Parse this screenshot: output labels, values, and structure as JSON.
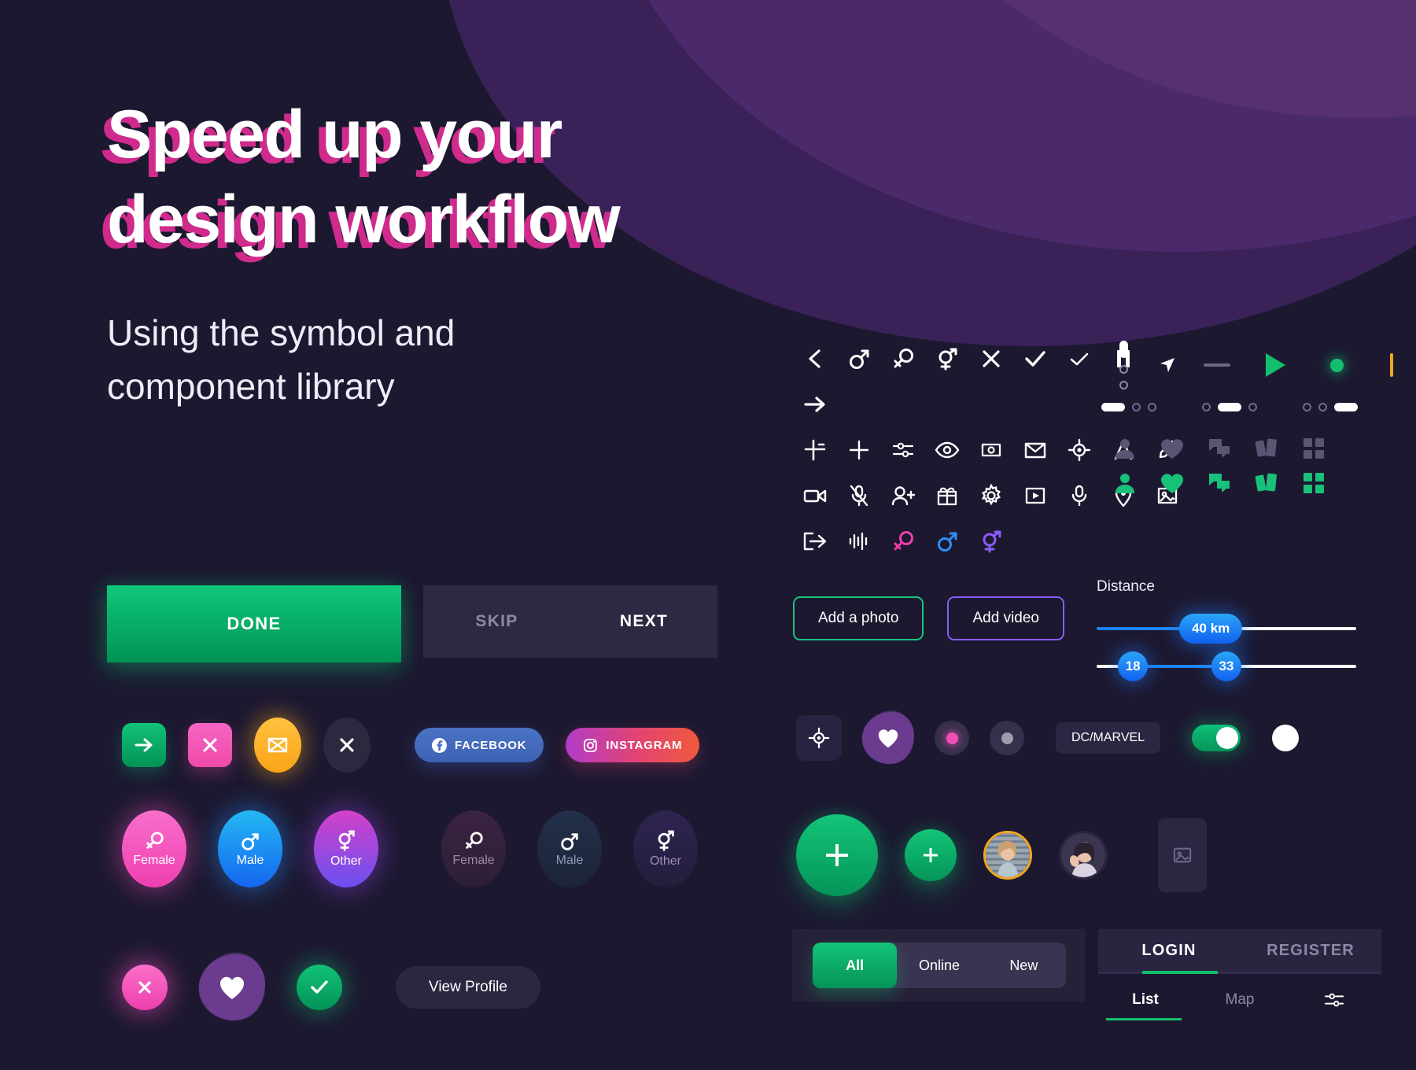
{
  "hero": {
    "title_line1": "Speed up your",
    "title_line2": "design workflow",
    "subtitle_line1": "Using the symbol and",
    "subtitle_line2": "component library"
  },
  "colors": {
    "background": "#1c1830",
    "accent_green": "#13bf6d",
    "accent_pink": "#ef3fb0",
    "accent_blue": "#1f8ef5",
    "accent_purple": "#8a5cf6",
    "accent_yellow": "#f5a623",
    "shadow_magenta": "#cf2b8c",
    "surface": "#2e2943",
    "muted_text": "#8e88a5"
  },
  "icon_grid": {
    "rows": [
      [
        "chevron-left-icon",
        "male-icon",
        "female-icon",
        "transgender-icon",
        "close-icon",
        "check-icon",
        "check-thin-icon",
        "pause-icon"
      ],
      [
        "arrow-right-icon"
      ],
      [
        "crop-icon",
        "crosshair-icon",
        "sliders-icon",
        "eye-icon",
        "photo-swap-icon",
        "mail-icon",
        "target-icon",
        "navigation-icon",
        "edit-icon"
      ],
      [
        "video-camera-icon",
        "mic-off-icon",
        "user-add-icon",
        "gift-icon",
        "gear-icon",
        "play-box-icon",
        "microphone-icon",
        "location-pin-icon",
        "image-icon"
      ],
      [
        "logout-icon",
        "audio-wave-icon",
        "female-pink-icon",
        "male-blue-icon",
        "transgender-purple-icon"
      ]
    ]
  },
  "control_strip": {
    "items": [
      "vertical-dots-indicator",
      "navigation-arrow-icon",
      "dash-line",
      "play-triangle-icon",
      "green-dot-indicator",
      "yellow-bar-indicator",
      "scatter-dots-icon",
      "ellipsis-pill-button"
    ],
    "pagers": [
      {
        "active_index": 0,
        "count": 3
      },
      {
        "active_index": 1,
        "count": 3
      },
      {
        "active_index": 2,
        "count": 3
      }
    ],
    "tab_icons": [
      "person-icon",
      "heart-icon",
      "chat-icon",
      "cards-icon",
      "grid-icon"
    ]
  },
  "cta": {
    "done_label": "DONE",
    "skip_label": "SKIP",
    "next_label": "NEXT"
  },
  "action_chips": {
    "arrow_icon": "arrow-right-icon",
    "close_icon": "close-icon",
    "mail_icon": "mail-icon",
    "close_dark_icon": "close-icon",
    "facebook_label": "FACEBOOK",
    "instagram_label": "INSTAGRAM"
  },
  "gender_options": {
    "active": [
      {
        "label": "Female",
        "icon": "female-icon"
      },
      {
        "label": "Male",
        "icon": "male-icon"
      },
      {
        "label": "Other",
        "icon": "transgender-icon"
      }
    ],
    "inactive": [
      {
        "label": "Female",
        "icon": "female-icon"
      },
      {
        "label": "Male",
        "icon": "male-icon"
      },
      {
        "label": "Other",
        "icon": "transgender-icon"
      }
    ]
  },
  "bottom_actions": {
    "dislike_icon": "close-icon",
    "favorite_icon": "heart-icon",
    "like_icon": "check-icon",
    "view_profile_label": "View Profile"
  },
  "media_buttons": {
    "add_photo_label": "Add a photo",
    "add_video_label": "Add video"
  },
  "sliders": {
    "distance_label": "Distance",
    "distance_value": "40 km",
    "distance_percent": 44,
    "range_min_value": "18",
    "range_max_value": "33",
    "range_min_percent": 14,
    "range_max_percent": 50
  },
  "misc_controls": {
    "target_icon": "target-icon",
    "heart_blob_icon": "heart-icon",
    "dot_pink": "dot-indicator",
    "dot_gray": "dot-indicator",
    "chip_label": "DC/MARVEL",
    "toggle_on": "toggle-on",
    "toggle_knob": "toggle-knob"
  },
  "fabs": {
    "large_icon": "plus-icon",
    "small_icon": "plus-icon",
    "avatar_1": "user-avatar",
    "avatar_2": "user-avatar",
    "placeholder_icon": "image-icon"
  },
  "segmented": {
    "options": [
      "All",
      "Online",
      "New"
    ],
    "active_index": 0
  },
  "tabs_panel": {
    "top_tabs": [
      "LOGIN",
      "REGISTER"
    ],
    "top_active_index": 0,
    "bottom_tabs": [
      "List",
      "Map"
    ],
    "bottom_active_index": 0,
    "filter_icon": "sliders-icon"
  }
}
